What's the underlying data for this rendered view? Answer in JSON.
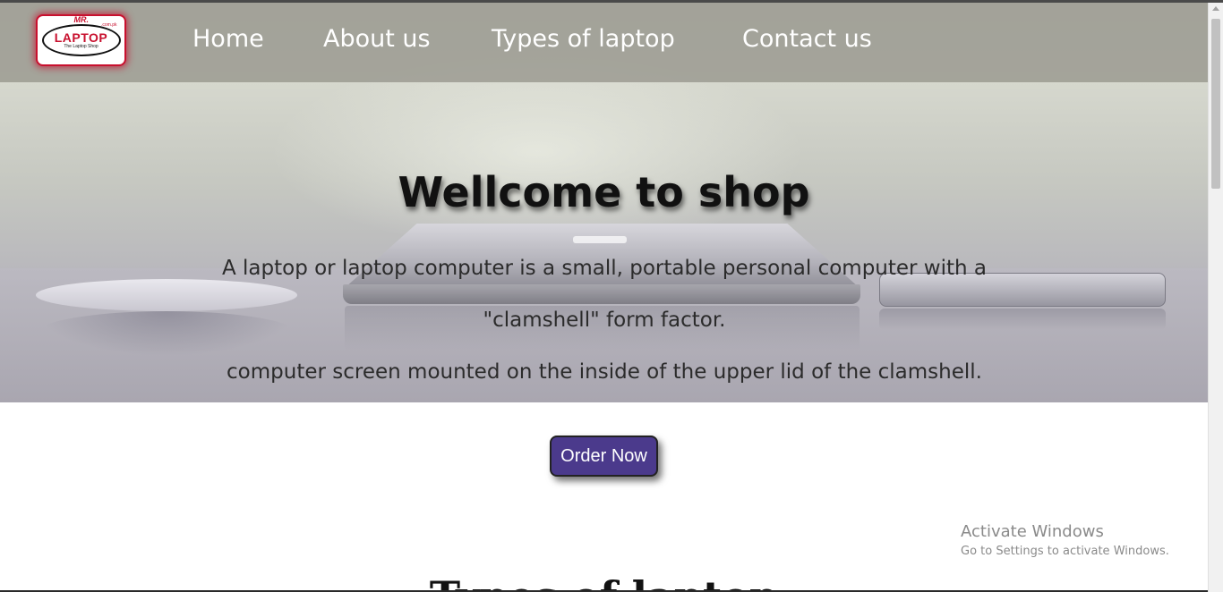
{
  "logo": {
    "brand_top": "MR.",
    "brand_main": "LAPTOP",
    "brand_domain": ".com.pk",
    "tagline": "The Laptop Shop"
  },
  "nav": {
    "items": [
      {
        "label": "Home"
      },
      {
        "label": "About us"
      },
      {
        "label": "Types of laptop"
      },
      {
        "label": "Contact us"
      }
    ]
  },
  "hero": {
    "title": "Wellcome to shop",
    "line1": "A laptop or laptop computer is a small, portable personal computer with a",
    "line2": "\"clamshell\" form factor.",
    "line3": "computer screen mounted on the inside of the upper lid of the clamshell."
  },
  "cta": {
    "order_label": "Order Now"
  },
  "next_section": {
    "heading": "Types of laptop"
  },
  "watermark": {
    "title": "Activate Windows",
    "subtitle": "Go to Settings to activate Windows."
  },
  "colors": {
    "button_bg": "#4b3a8c",
    "logo_red": "#c8102e",
    "nav_text": "#ffffff"
  }
}
